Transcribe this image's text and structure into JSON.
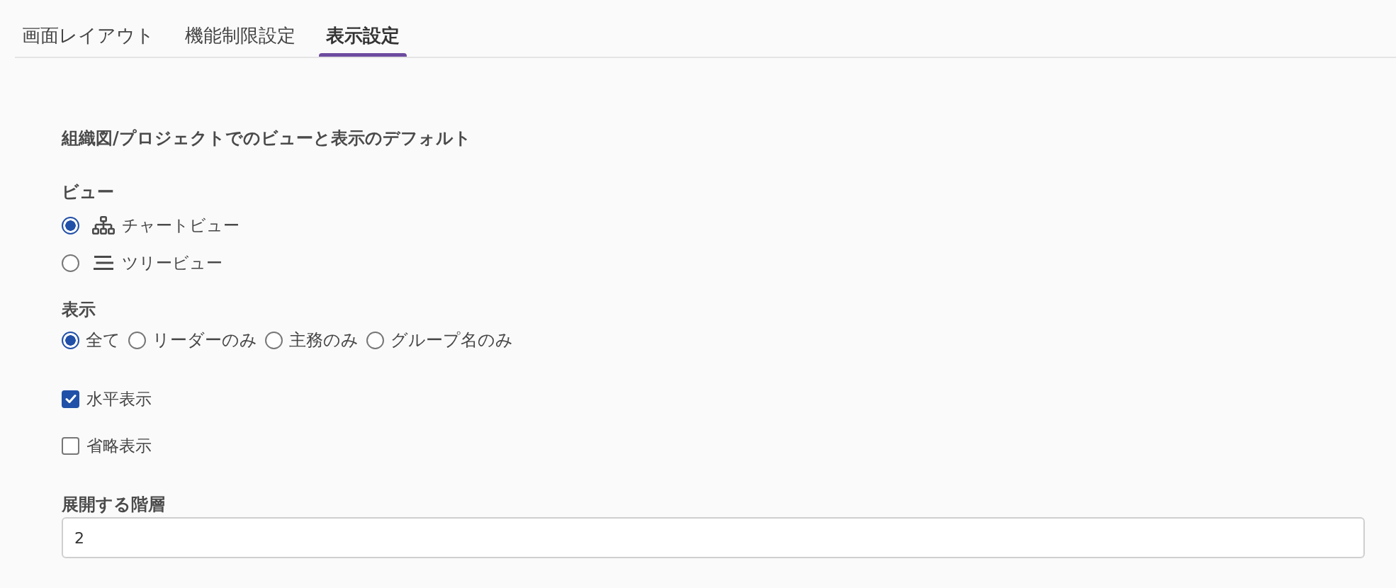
{
  "tabs": [
    {
      "label": "画面レイアウト",
      "selected": false
    },
    {
      "label": "機能制限設定",
      "selected": false
    },
    {
      "label": "表示設定",
      "selected": true
    }
  ],
  "section_title": "組織図/プロジェクトでのビューと表示のデフォルト",
  "view": {
    "label": "ビュー",
    "options": [
      {
        "label": "チャートビュー",
        "kind": "chart",
        "selected": true
      },
      {
        "label": "ツリービュー",
        "kind": "tree",
        "selected": false
      }
    ]
  },
  "display": {
    "label": "表示",
    "options": [
      {
        "label": "全て",
        "selected": true
      },
      {
        "label": "リーダーのみ",
        "selected": false
      },
      {
        "label": "主務のみ",
        "selected": false
      },
      {
        "label": "グループ名のみ",
        "selected": false
      }
    ]
  },
  "checkboxes": [
    {
      "label": "水平表示",
      "checked": true
    },
    {
      "label": "省略表示",
      "checked": false
    }
  ],
  "expand_level": {
    "label": "展開する階層",
    "value": "2"
  }
}
